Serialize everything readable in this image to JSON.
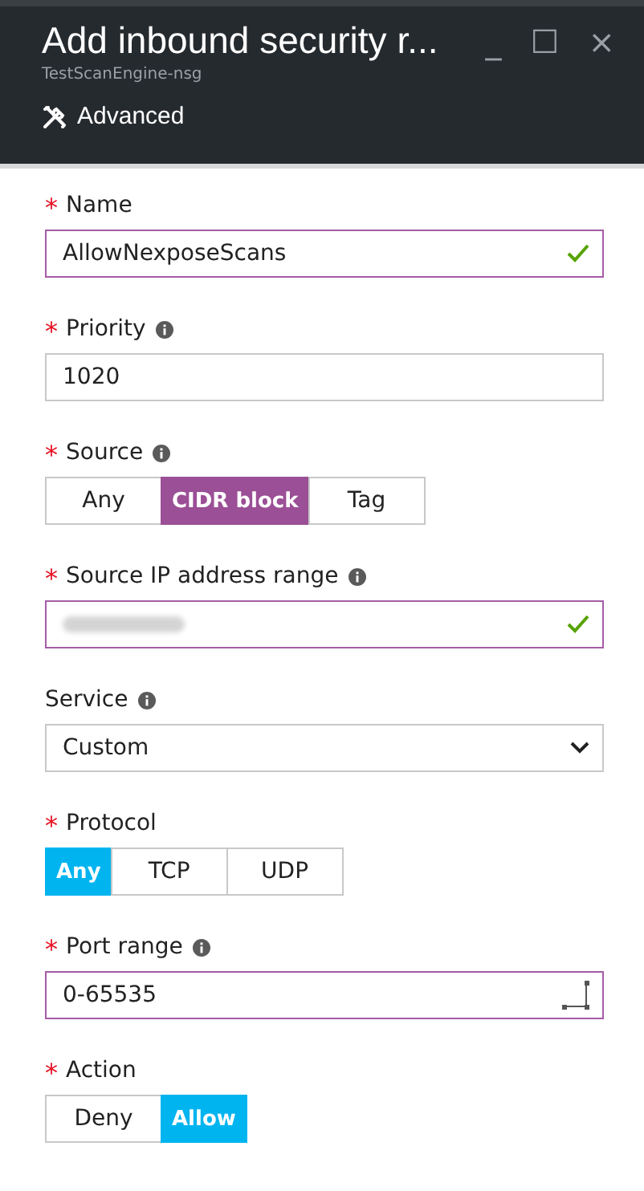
{
  "window": {
    "title": "Add inbound security r...",
    "subtitle": "TestScanEngine-nsg",
    "controls": [
      "_",
      "☐",
      "×"
    ]
  },
  "toolbar": {
    "label": "Advanced"
  },
  "fields": [
    {
      "kind": "text",
      "label": "Name",
      "required_mark": "*",
      "info": false,
      "value": "AllowNexposeScans",
      "valid": true,
      "focused": true
    },
    {
      "kind": "text",
      "label": "Priority",
      "required_mark": "*",
      "info": true,
      "value": "1020",
      "valid": false,
      "focused": false
    },
    {
      "kind": "toggle",
      "label": "Source",
      "required_mark": "*",
      "info": true,
      "color": "#9b4f96",
      "options": [
        {
          "label": "Any",
          "selected": false
        },
        {
          "label": "CIDR block",
          "selected": true
        },
        {
          "label": "Tag",
          "selected": false
        }
      ]
    },
    {
      "kind": "text",
      "label": "Source IP address range",
      "required_mark": "*",
      "info": true,
      "redacted": true,
      "valid": true,
      "focused": true
    },
    {
      "kind": "select",
      "label": "Service",
      "info": true,
      "value": "Custom"
    },
    {
      "kind": "toggle",
      "label": "Protocol",
      "required_mark": "*",
      "info": false,
      "color": "#00b4f0",
      "options": [
        {
          "label": "Any",
          "selected": true
        },
        {
          "label": "TCP",
          "selected": false
        },
        {
          "label": "UDP",
          "selected": false
        }
      ]
    },
    {
      "kind": "text",
      "label": "Port range",
      "required_mark": "*",
      "info": true,
      "value": "0-65535",
      "valid": false,
      "focused": true,
      "resize": true
    },
    {
      "kind": "toggle",
      "label": "Action",
      "required_mark": "*",
      "info": false,
      "color": "#00b4f0",
      "options": [
        {
          "label": "Deny",
          "selected": false
        },
        {
          "label": "Allow",
          "selected": true
        }
      ]
    }
  ]
}
